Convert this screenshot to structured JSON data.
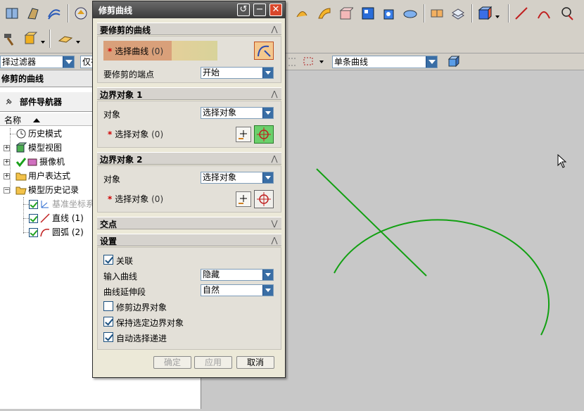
{
  "toolbar": {
    "filter_combo": "择过滤器",
    "second_combo": "仅在",
    "selection_combo": "单条曲线"
  },
  "nav": {
    "pane_title": "修剪的曲线",
    "navigator_title": "部件导航器",
    "column_name": "名称",
    "items": [
      {
        "label": "历史模式"
      },
      {
        "label": "模型视图"
      },
      {
        "label": "摄像机"
      },
      {
        "label": "用户表达式"
      },
      {
        "label": "模型历史记录"
      },
      {
        "label": "基准坐标系"
      },
      {
        "label": "直线 (1)"
      },
      {
        "label": "圆弧 (2)"
      }
    ]
  },
  "dialog": {
    "title": "修剪曲线",
    "sec1": {
      "title": "要修剪的曲线",
      "select_curve": "选择曲线",
      "select_curve_count": "(0)",
      "end_label": "要修剪的端点",
      "end_value": "开始"
    },
    "sec2": {
      "title": "边界对象 1",
      "object_label": "对象",
      "object_value": "选择对象",
      "select_label": "选择对象",
      "select_count": "(0)"
    },
    "sec3": {
      "title": "边界对象 2",
      "object_label": "对象",
      "object_value": "选择对象",
      "select_label": "选择对象",
      "select_count": "(0)"
    },
    "sec4": {
      "title": "交点"
    },
    "sec5": {
      "title": "设置",
      "associative": "关联",
      "input_curve_label": "输入曲线",
      "input_curve_value": "隐藏",
      "extension_label": "曲线延伸段",
      "extension_value": "自然",
      "trim_boundary": "修剪边界对象",
      "keep_boundary": "保持选定边界对象",
      "auto_advance": "自动选择递进"
    },
    "buttons": {
      "ok": "确定",
      "apply": "应用",
      "cancel": "取消"
    }
  },
  "colors": {
    "curve": "#12a012",
    "dialog_title": "#4a4a4a",
    "required": "#d00000"
  }
}
